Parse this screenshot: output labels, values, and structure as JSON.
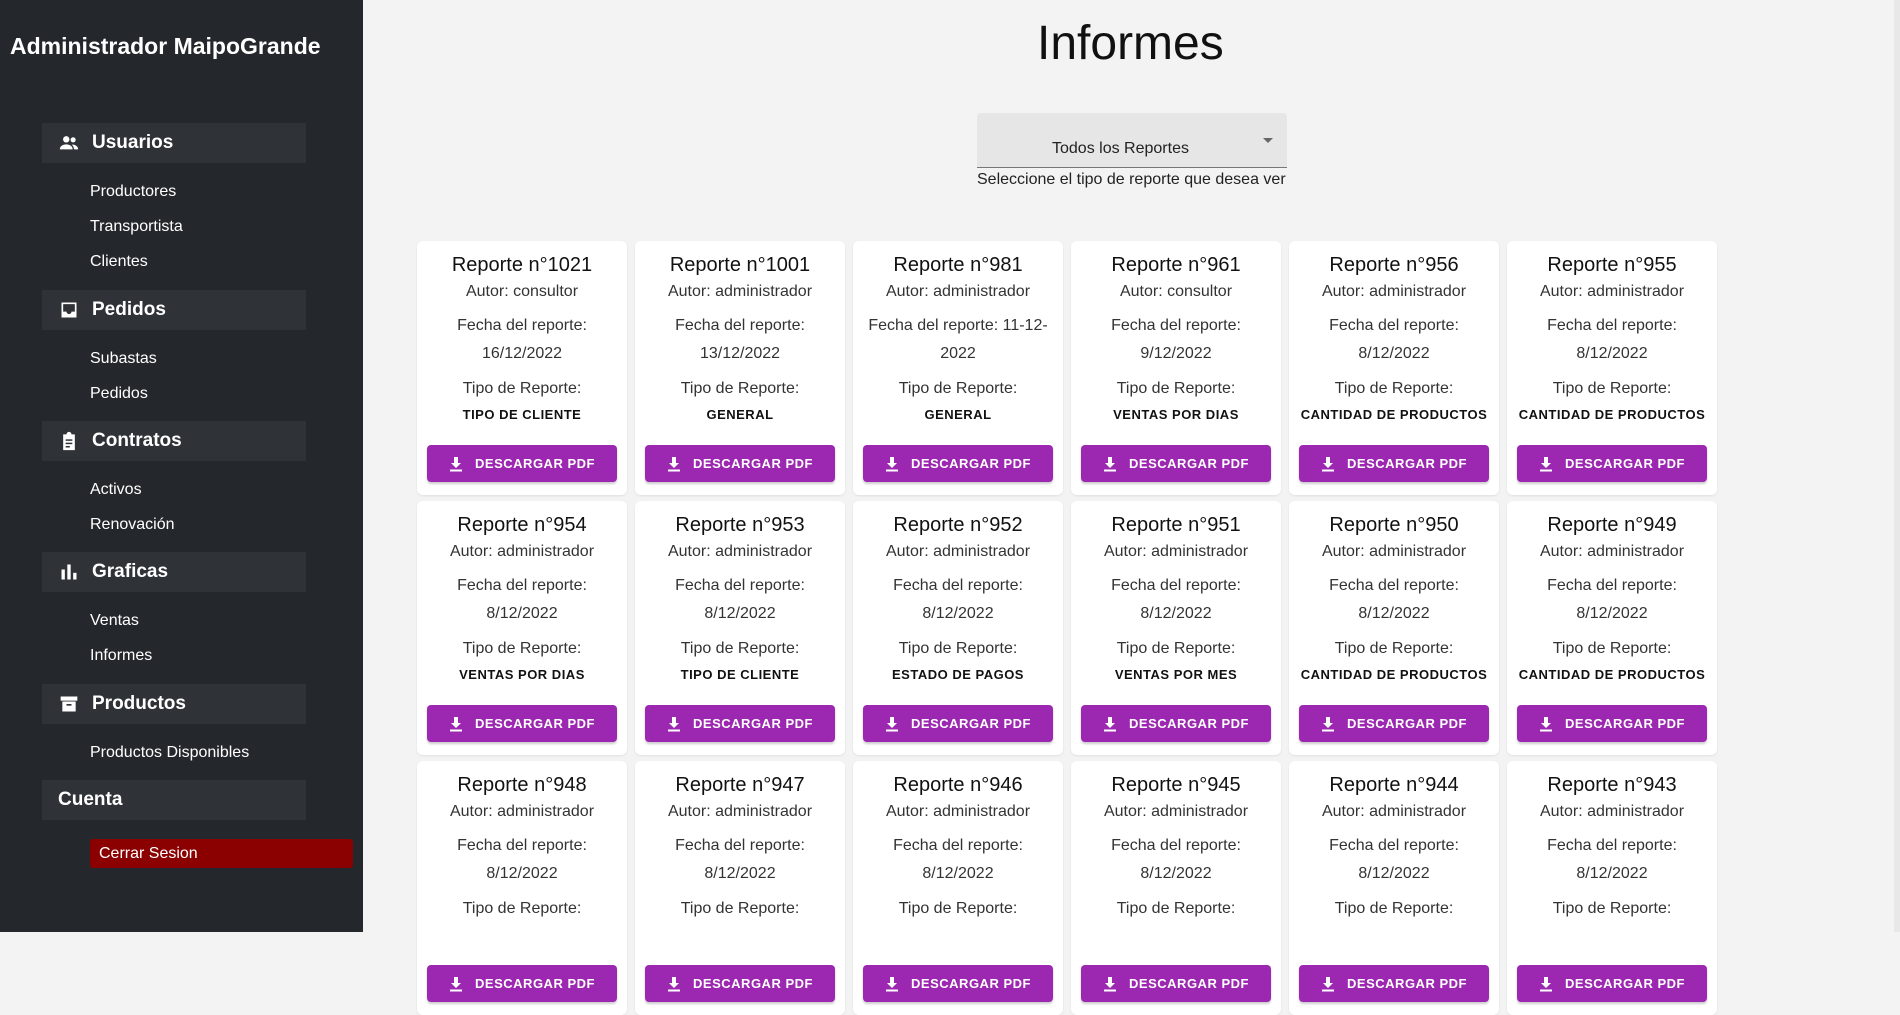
{
  "sidebar": {
    "brand": "Administrador MaipoGrande",
    "sections": [
      {
        "label": "Usuarios",
        "icon": "users-icon",
        "items": [
          "Productores",
          "Transportista",
          "Clientes"
        ]
      },
      {
        "label": "Pedidos",
        "icon": "inbox-icon",
        "items": [
          "Subastas",
          "Pedidos"
        ]
      },
      {
        "label": "Contratos",
        "icon": "clipboard-icon",
        "items": [
          "Activos",
          "Renovación"
        ]
      },
      {
        "label": "Graficas",
        "icon": "bar-chart-icon",
        "items": [
          "Ventas",
          "Informes"
        ]
      },
      {
        "label": "Productos",
        "icon": "archive-icon",
        "items": [
          "Productos Disponibles"
        ]
      },
      {
        "label": "Cuenta",
        "items": []
      }
    ],
    "logout": "Cerrar Sesion",
    "logout_color": "#8b0000"
  },
  "main": {
    "title": "Informes",
    "filter": {
      "value": "Todos los Reportes",
      "helper": "Seleccione el tipo de reporte que desea ver"
    },
    "labels": {
      "author_prefix": "Autor: ",
      "date_label": "Fecha del reporte: ",
      "type_label": "Tipo de Reporte:",
      "download": "DESCARGAR PDF"
    },
    "accent_color": "#9c27b0",
    "reports": [
      {
        "title": "Reporte n°1021",
        "author": "consultor",
        "date": "16/12/2022",
        "type": "TIPO DE CLIENTE"
      },
      {
        "title": "Reporte n°1001",
        "author": "administrador",
        "date": "13/12/2022",
        "type": "GENERAL"
      },
      {
        "title": "Reporte n°981",
        "author": "administrador",
        "date": "11-12-2022",
        "type": "GENERAL"
      },
      {
        "title": "Reporte n°961",
        "author": "consultor",
        "date": "9/12/2022",
        "type": "VENTAS POR DIAS"
      },
      {
        "title": "Reporte n°956",
        "author": "administrador",
        "date": "8/12/2022",
        "type": "CANTIDAD DE PRODUCTOS"
      },
      {
        "title": "Reporte n°955",
        "author": "administrador",
        "date": "8/12/2022",
        "type": "CANTIDAD DE PRODUCTOS"
      },
      {
        "title": "Reporte n°954",
        "author": "administrador",
        "date": "8/12/2022",
        "type": "VENTAS POR DIAS"
      },
      {
        "title": "Reporte n°953",
        "author": "administrador",
        "date": "8/12/2022",
        "type": "TIPO DE CLIENTE"
      },
      {
        "title": "Reporte n°952",
        "author": "administrador",
        "date": "8/12/2022",
        "type": "ESTADO DE PAGOS"
      },
      {
        "title": "Reporte n°951",
        "author": "administrador",
        "date": "8/12/2022",
        "type": "VENTAS POR MES"
      },
      {
        "title": "Reporte n°950",
        "author": "administrador",
        "date": "8/12/2022",
        "type": "CANTIDAD DE PRODUCTOS"
      },
      {
        "title": "Reporte n°949",
        "author": "administrador",
        "date": "8/12/2022",
        "type": "CANTIDAD DE PRODUCTOS"
      },
      {
        "title": "Reporte n°948",
        "author": "administrador",
        "date": "8/12/2022",
        "type": ""
      },
      {
        "title": "Reporte n°947",
        "author": "administrador",
        "date": "8/12/2022",
        "type": ""
      },
      {
        "title": "Reporte n°946",
        "author": "administrador",
        "date": "8/12/2022",
        "type": ""
      },
      {
        "title": "Reporte n°945",
        "author": "administrador",
        "date": "8/12/2022",
        "type": ""
      },
      {
        "title": "Reporte n°944",
        "author": "administrador",
        "date": "8/12/2022",
        "type": ""
      },
      {
        "title": "Reporte n°943",
        "author": "administrador",
        "date": "8/12/2022",
        "type": ""
      }
    ]
  }
}
